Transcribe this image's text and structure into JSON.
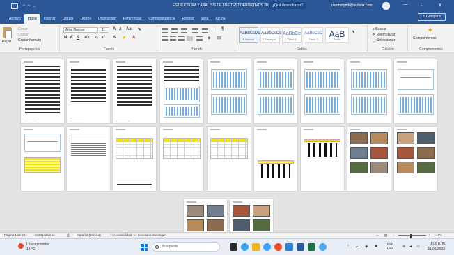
{
  "window": {
    "title": "ESTRUCTURA Y ANALISIS DE LOS TEST DEPORTIVOS 2023 (1) - Word",
    "search_placeholder": "¿Qué desea hacer?",
    "account": "joaomotpmh@outlook.com",
    "controls": [
      "—",
      "□",
      "✕"
    ]
  },
  "tabs": [
    "Archivo",
    "Inicio",
    "Insertar",
    "Dibujar",
    "Diseño",
    "Disposición",
    "Referencias",
    "Correspondencia",
    "Revisar",
    "Vista",
    "Ayuda"
  ],
  "active_tab": "Inicio",
  "share_label": "Compartir",
  "ribbon": {
    "clipboard": {
      "paste": "Pegar",
      "cut": "Cortar",
      "copy": "Copiar",
      "format_painter": "Copiar formato",
      "label": "Portapapeles"
    },
    "font": {
      "font_name": "Arial Narrow",
      "font_size": "11",
      "label": "Fuente"
    },
    "paragraph": {
      "label": "Párrafo"
    },
    "styles": {
      "label": "Estilos",
      "items": [
        {
          "sample": "AaBbCcDc",
          "name": "¶ Normal"
        },
        {
          "sample": "AaBbCcDc",
          "name": "¶ Sin espa..."
        },
        {
          "sample": "AaBbCc",
          "name": "Título 1"
        },
        {
          "sample": "AaBbCcC",
          "name": "Título 2"
        },
        {
          "sample": "AaB",
          "name": "Título"
        }
      ]
    },
    "editing": {
      "find": "Buscar",
      "replace": "Reemplazar",
      "select": "Seleccionar",
      "label": "Edición"
    },
    "addins": {
      "button": "Complementos",
      "label": "Complementos"
    }
  },
  "status": {
    "page": "Página 1 de 20",
    "words": "2224 palabras",
    "language": "Español (México)",
    "accessibility": "Accesibilidad: es necesario investigar",
    "zoom": "17%",
    "zoom_fraction": 0.45
  },
  "taskbar": {
    "weather_title": "Lluvia próxima",
    "weather_temp": "18 °C",
    "search_label": "Búsqueda",
    "lang": "ESP LAA",
    "time": "1:08 p. m.",
    "date": "31/05/2023"
  },
  "colors": {
    "title_bar": "#2b5797",
    "chart_blue": "#5f9fd8",
    "table_yellow": "#f4e800",
    "photo_tones": [
      "#8a6b4f",
      "#b78a5b",
      "#6f7f8f",
      "#a5563d",
      "#556b42",
      "#9c8a7a",
      "#c9a27e",
      "#4f5e6d"
    ]
  }
}
